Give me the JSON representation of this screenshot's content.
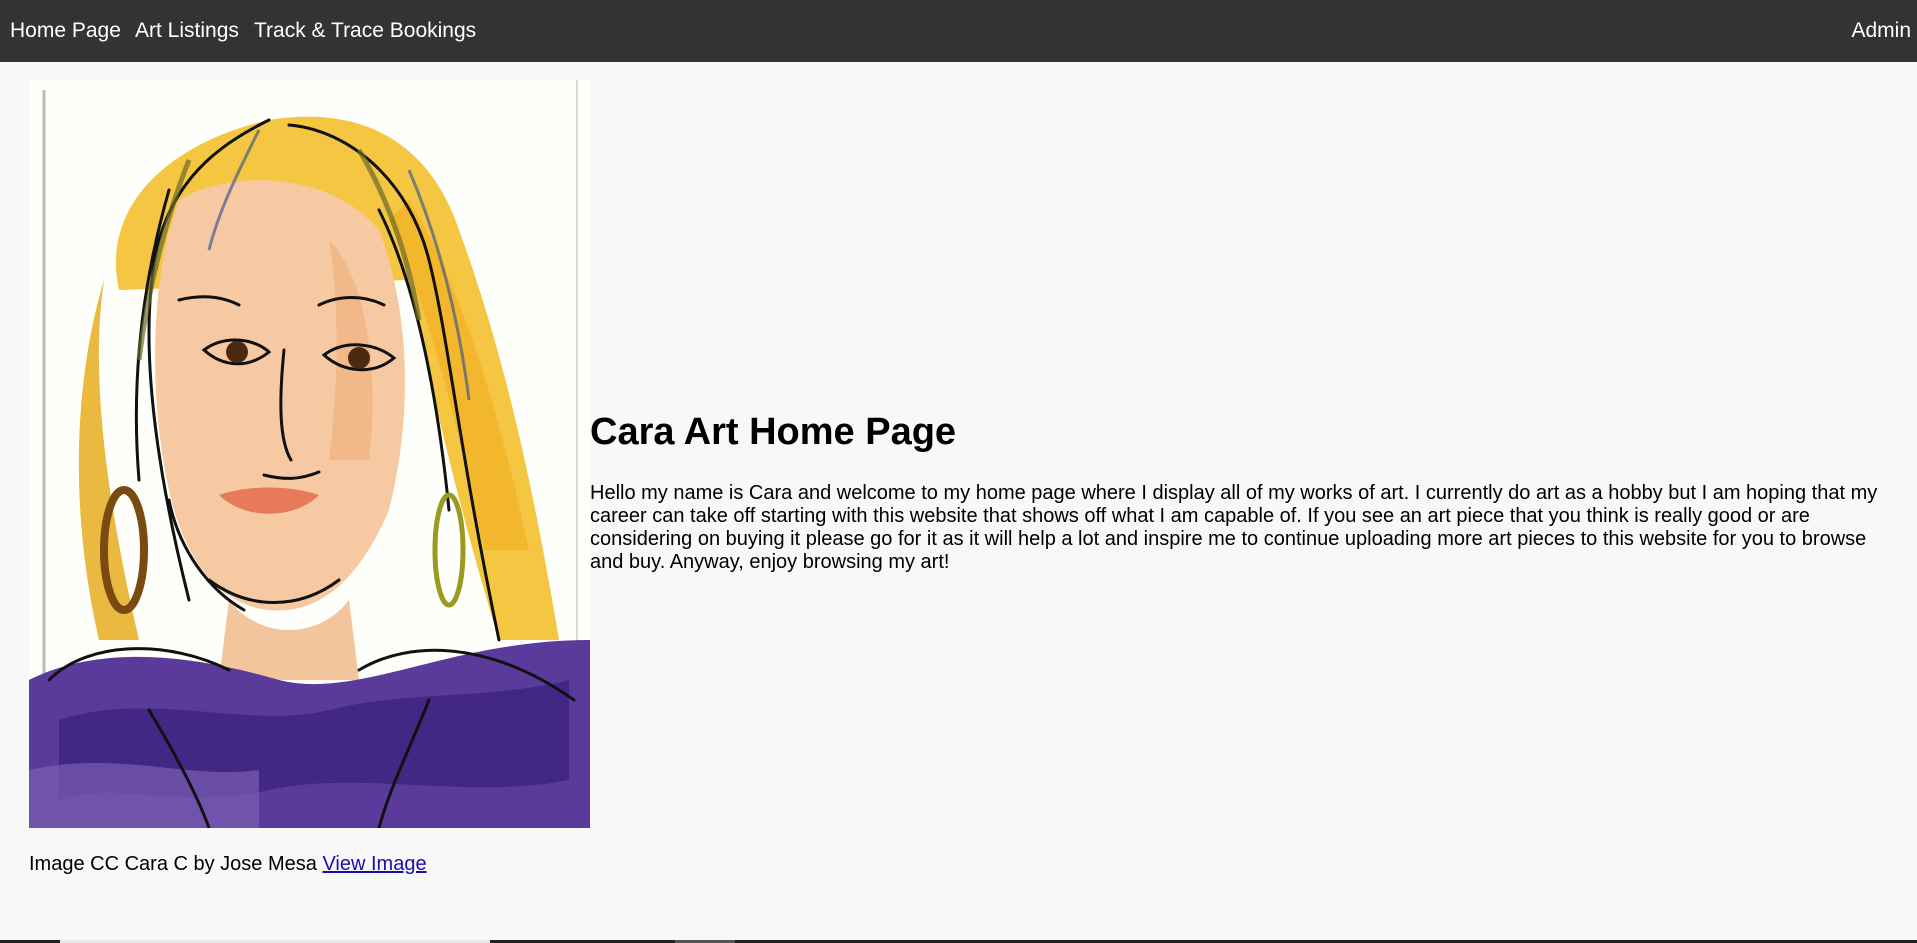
{
  "nav": {
    "home": "Home Page",
    "art_listings": "Art Listings",
    "track_trace": "Track & Trace Bookings",
    "admin": "Admin"
  },
  "hero_image": {
    "icon": "portrait-painting"
  },
  "caption": {
    "text": "Image CC Cara C by Jose Mesa ",
    "link": "View Image"
  },
  "main": {
    "title": "Cara Art Home Page",
    "intro": "Hello my name is Cara and welcome to my home page where I display all of my works of art. I currently do art as a hobby but I am hoping that my career can take off starting with this website that shows off what I am capable of. If you see an art piece that you think is really good or are considering on buying it please go for it as it will help a lot and inspire me to continue uploading more art pieces to this website for you to browse and buy. Anyway, enjoy browsing my art!"
  },
  "colors": {
    "navbar": "#333333",
    "page_background": "#f8f8f9",
    "link": "#1a0dab"
  }
}
